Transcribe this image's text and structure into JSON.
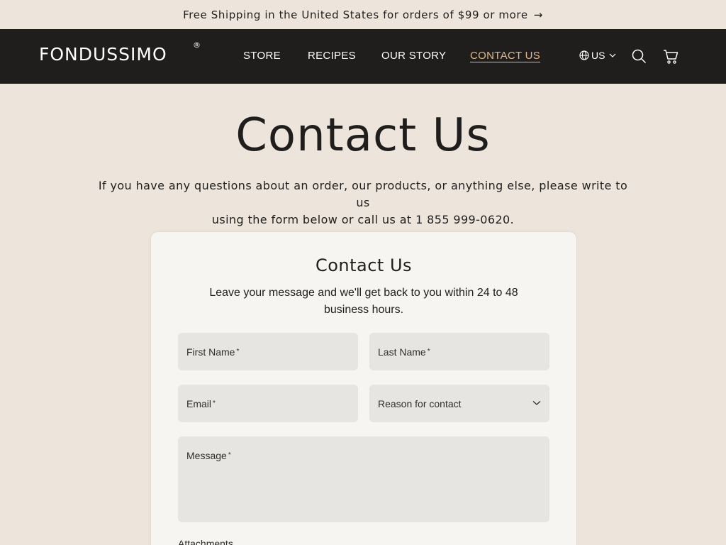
{
  "announcement": {
    "text": "Free Shipping in the United States for orders of $99 or more",
    "arrow": "→"
  },
  "header": {
    "logo": "FONDUSSIMO",
    "logo_mark": "®",
    "nav": [
      {
        "label": "STORE"
      },
      {
        "label": "RECIPES"
      },
      {
        "label": "OUR STORY"
      },
      {
        "label": "CONTACT US",
        "active": true
      }
    ],
    "locale": "US",
    "icons": [
      "globe-icon",
      "chevron-down-icon",
      "search-icon",
      "cart-icon"
    ],
    "accent_color": "#e3b98b",
    "bg_color": "#1f1e1c"
  },
  "page": {
    "title": "Contact Us",
    "intro_line1": "If you have any questions about an order, our products, or anything else, please write to us",
    "intro_line2": "using the form below or call us at 1 855 999-0620."
  },
  "form": {
    "title": "Contact Us",
    "subtitle": "Leave your message and we'll get back to you within 24 to 48 business hours.",
    "first_name": {
      "label": "First Name",
      "required": "*",
      "value": ""
    },
    "last_name": {
      "label": "Last Name",
      "required": "*",
      "value": ""
    },
    "email": {
      "label": "Email",
      "required": "*",
      "value": ""
    },
    "reason": {
      "label": "Reason for contact"
    },
    "message": {
      "label": "Message",
      "required": "*",
      "value": ""
    },
    "attachments_label": "Attachments"
  }
}
